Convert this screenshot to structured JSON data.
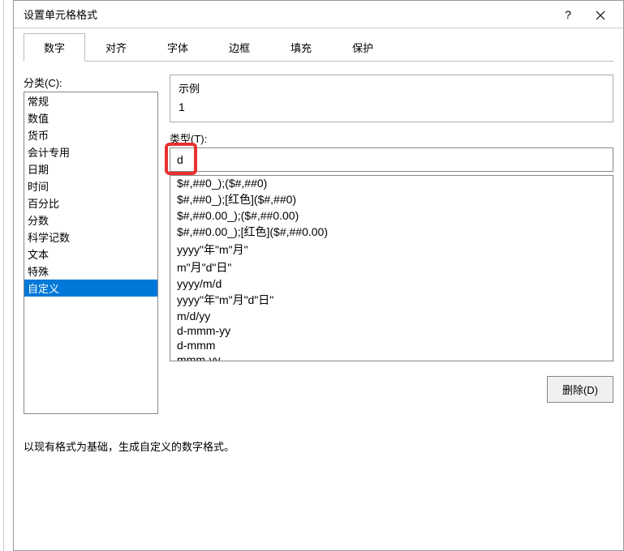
{
  "dialog": {
    "title": "设置单元格格式",
    "help": "?",
    "close": "×"
  },
  "tabs": [
    {
      "label": "数字",
      "active": true
    },
    {
      "label": "对齐",
      "active": false
    },
    {
      "label": "字体",
      "active": false
    },
    {
      "label": "边框",
      "active": false
    },
    {
      "label": "填充",
      "active": false
    },
    {
      "label": "保护",
      "active": false
    }
  ],
  "category": {
    "label": "分类(C):",
    "items": [
      {
        "label": "常规",
        "selected": false
      },
      {
        "label": "数值",
        "selected": false
      },
      {
        "label": "货币",
        "selected": false
      },
      {
        "label": "会计专用",
        "selected": false
      },
      {
        "label": "日期",
        "selected": false
      },
      {
        "label": "时间",
        "selected": false
      },
      {
        "label": "百分比",
        "selected": false
      },
      {
        "label": "分数",
        "selected": false
      },
      {
        "label": "科学记数",
        "selected": false
      },
      {
        "label": "文本",
        "selected": false
      },
      {
        "label": "特殊",
        "selected": false
      },
      {
        "label": "自定义",
        "selected": true
      }
    ]
  },
  "sample": {
    "label": "示例",
    "value": "1"
  },
  "type": {
    "label": "类型(T):",
    "value": "d"
  },
  "formats": [
    "$#,##0_);($#,##0)",
    "$#,##0_);[红色]($#,##0)",
    "$#,##0.00_);($#,##0.00)",
    "$#,##0.00_);[红色]($#,##0.00)",
    "yyyy\"年\"m\"月\"",
    "m\"月\"d\"日\"",
    "yyyy/m/d",
    "yyyy\"年\"m\"月\"d\"日\"",
    "m/d/yy",
    "d-mmm-yy",
    "d-mmm",
    "mmm-yy"
  ],
  "delete_label": "删除(D)",
  "hint": "以现有格式为基础，生成自定义的数字格式。"
}
